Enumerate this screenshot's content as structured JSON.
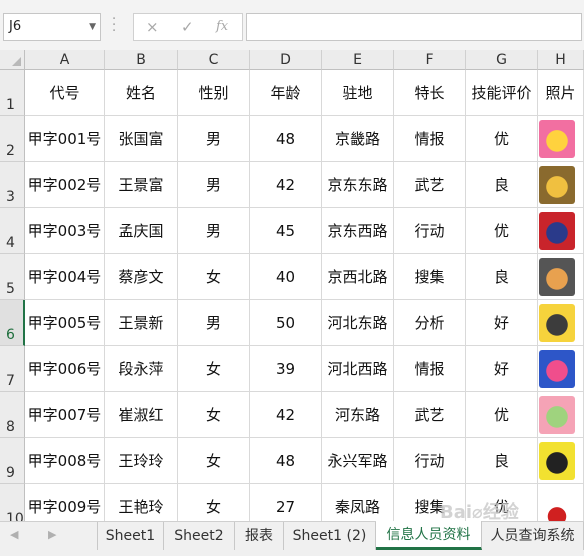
{
  "formula_bar": {
    "name_box": "J6",
    "cancel_icon": "×",
    "enter_icon": "✓",
    "fx_label": "fx",
    "formula": ""
  },
  "columns": [
    "A",
    "B",
    "C",
    "D",
    "E",
    "F",
    "G",
    "H"
  ],
  "row_numbers": [
    "1",
    "2",
    "3",
    "4",
    "5",
    "6",
    "7",
    "8",
    "9",
    "10"
  ],
  "active_row": "6",
  "headers": [
    "代号",
    "姓名",
    "性别",
    "年龄",
    "驻地",
    "特长",
    "技能评价",
    "照片"
  ],
  "rows": [
    [
      "甲字001号",
      "张国富",
      "男",
      "48",
      "京畿路",
      "情报",
      "优"
    ],
    [
      "甲字002号",
      "王景富",
      "男",
      "42",
      "京东东路",
      "武艺",
      "良"
    ],
    [
      "甲字003号",
      "孟庆国",
      "男",
      "45",
      "京东西路",
      "行动",
      "优"
    ],
    [
      "甲字004号",
      "蔡彦文",
      "女",
      "40",
      "京西北路",
      "搜集",
      "良"
    ],
    [
      "甲字005号",
      "王景新",
      "男",
      "50",
      "河北东路",
      "分析",
      "好"
    ],
    [
      "甲字006号",
      "段永萍",
      "女",
      "39",
      "河北西路",
      "情报",
      "好"
    ],
    [
      "甲字007号",
      "崔淑红",
      "女",
      "42",
      "河东路",
      "武艺",
      "优"
    ],
    [
      "甲字008号",
      "王玲玲",
      "女",
      "48",
      "永兴军路",
      "行动",
      "良"
    ],
    [
      "甲字009号",
      "王艳玲",
      "女",
      "27",
      "秦凤路",
      "搜集",
      "优"
    ]
  ],
  "sheet_tabs": [
    "Sheet1",
    "Sheet2",
    "报表",
    "Sheet1 (2)",
    "信息人员资料",
    "人员查询系统"
  ],
  "active_tab": "信息人员资料",
  "colors": {
    "accent": "#217346",
    "grid": "#d9d9d9",
    "header_bg": "#ececec"
  }
}
